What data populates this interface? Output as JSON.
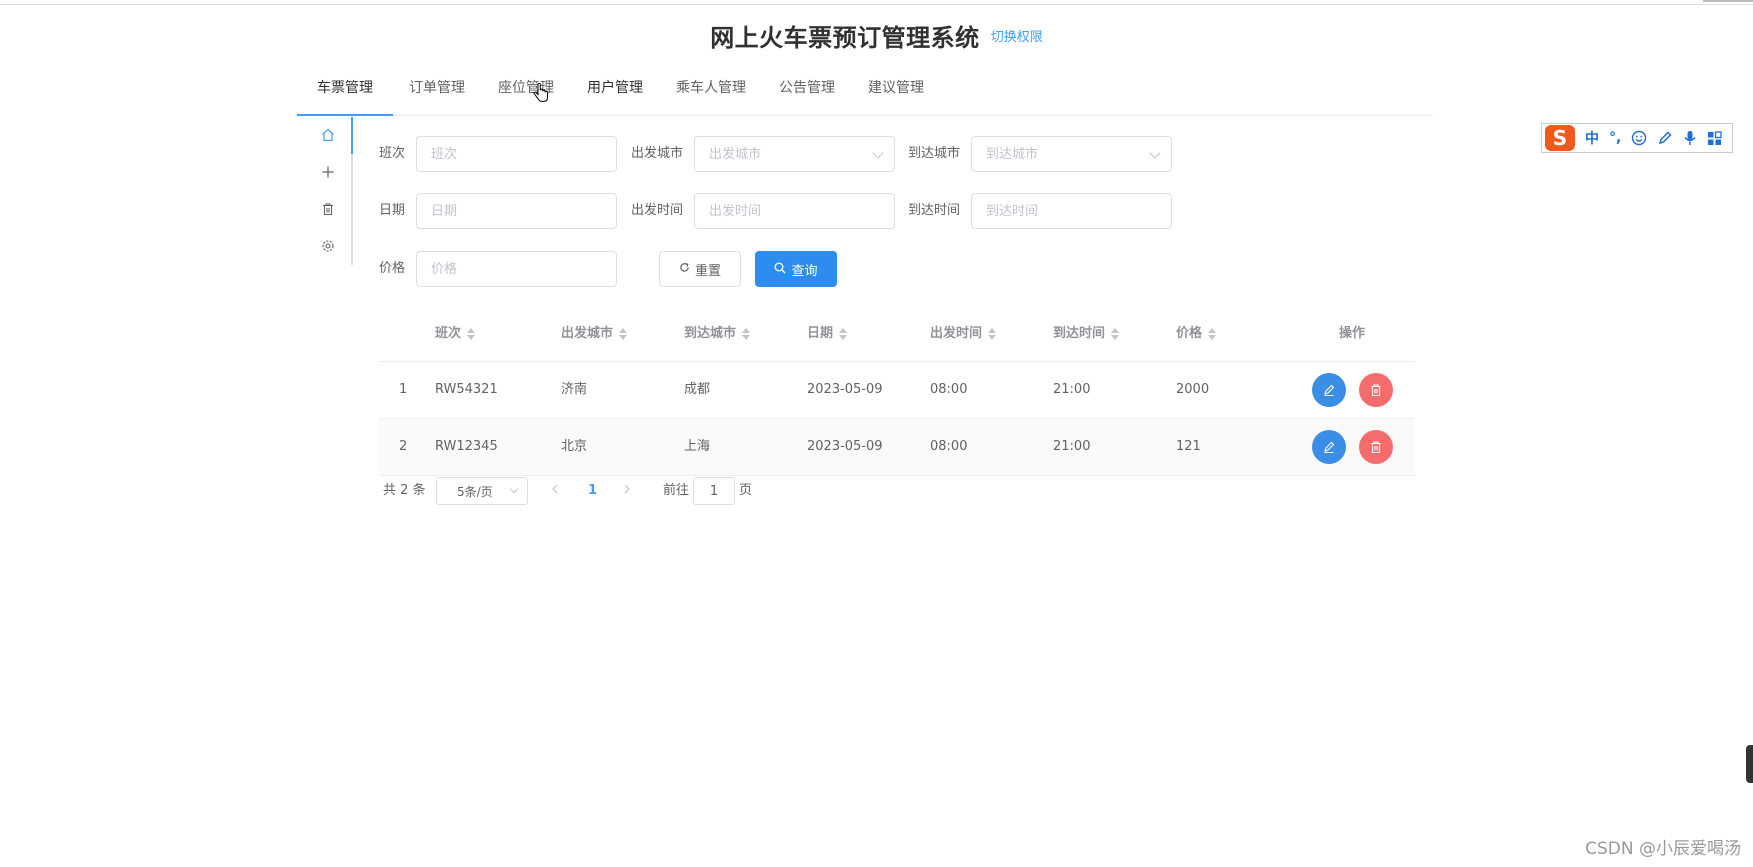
{
  "header": {
    "title": "网上火车票预订管理系统",
    "switch_link": "切换权限"
  },
  "nav": {
    "tabs": [
      "车票管理",
      "订单管理",
      "座位管理",
      "用户管理",
      "乘车人管理",
      "公告管理",
      "建议管理"
    ],
    "active": "车票管理"
  },
  "sidebar": {
    "icons": [
      "home-icon",
      "plus-icon",
      "trash-icon",
      "gear-icon"
    ]
  },
  "search": {
    "banci_label": "班次",
    "banci_placeholder": "班次",
    "from_label": "出发城市",
    "from_placeholder": "出发城市",
    "to_label": "到达城市",
    "to_placeholder": "到达城市",
    "date_label": "日期",
    "date_placeholder": "日期",
    "depart_label": "出发时间",
    "depart_placeholder": "出发时间",
    "arrive_label": "到达时间",
    "arrive_placeholder": "到达时间",
    "price_label": "价格",
    "price_placeholder": "价格",
    "reset_label": "重置",
    "search_label": "查询"
  },
  "table": {
    "headers": [
      "班次",
      "出发城市",
      "到达城市",
      "日期",
      "出发时间",
      "到达时间",
      "价格",
      "操作"
    ],
    "rows": [
      {
        "index": "1",
        "banci": "RW54321",
        "from": "济南",
        "to": "成都",
        "date": "2023-05-09",
        "depart": "08:00",
        "arrive": "21:00",
        "price": "2000"
      },
      {
        "index": "2",
        "banci": "RW12345",
        "from": "北京",
        "to": "上海",
        "date": "2023-05-09",
        "depart": "08:00",
        "arrive": "21:00",
        "price": "121"
      }
    ]
  },
  "pagination": {
    "total": "共 2 条",
    "page_size": "5条/页",
    "current": "1",
    "goto_label": "前往",
    "goto_value": "1",
    "page_suffix": "页"
  },
  "ime": {
    "logo": "S",
    "items": [
      "中",
      "°,"
    ]
  },
  "watermark": "CSDN @小辰爱喝汤",
  "colors": {
    "primary": "#409eff",
    "search_button": "#2d8cf0",
    "danger": "#f56c6c",
    "ime_logo": "#f25a1d"
  }
}
